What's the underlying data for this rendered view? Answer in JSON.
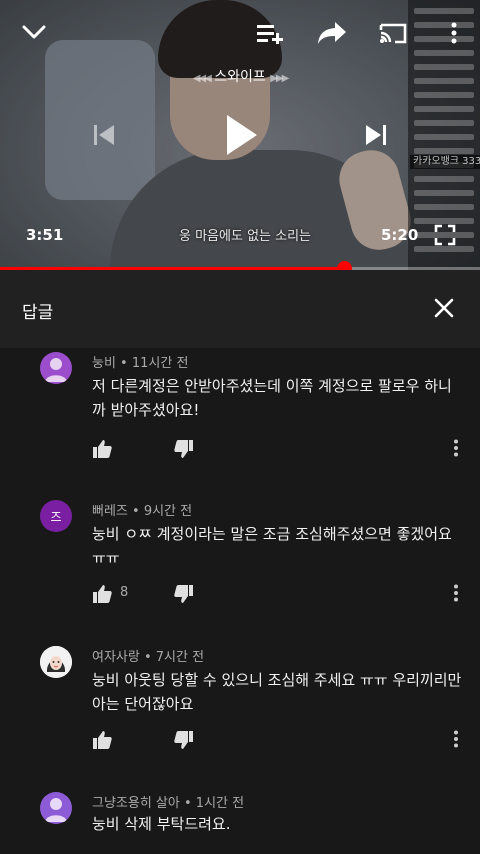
{
  "player": {
    "swipe_label": "스와이프",
    "swipe_left_arrows": "◀◀◀",
    "swipe_right_arrows": "▶▶▶",
    "current_time": "3:51",
    "duration": "5:20",
    "caption": "웅 마음에도 없는 소리는",
    "progress_fraction": 0.717,
    "chat_banner": "카카오뱅크 333",
    "colors": {
      "progress": "#ff0000",
      "accent": "#ffffff"
    }
  },
  "panel": {
    "title": "답글"
  },
  "comments": [
    {
      "author": "눙비",
      "time": "11시간 전",
      "text": "저 다른계정은 안받아주셨는데 이쪽 계정으로 팔로우 하니까 받아주셨아요!",
      "likes": "",
      "avatar_initial": "",
      "avatar_color": "#9c4dcc"
    },
    {
      "author": "뻐레즈",
      "time": "9시간 전",
      "text": "눙비 ㅇㅉ 계정이라는 말은 조금 조심해주셨으면 좋겠어요 ㅠㅠ",
      "likes": "8",
      "avatar_initial": "즈",
      "avatar_color": "#7b1fa2"
    },
    {
      "author": "여자사랑",
      "time": "7시간 전",
      "text": "눙비 아웃팅 당할 수 있으니 조심해 주세요 ㅠㅠ 우리끼리만 아는 단어잖아요",
      "likes": "",
      "avatar_initial": "",
      "avatar_color": "#f2f2f2"
    },
    {
      "author": "그냥조용히 살아",
      "time": "1시간 전",
      "text": "눙비 삭제 부탁드려요.",
      "likes": "",
      "avatar_initial": "",
      "avatar_color": "#8e5bd6"
    }
  ]
}
